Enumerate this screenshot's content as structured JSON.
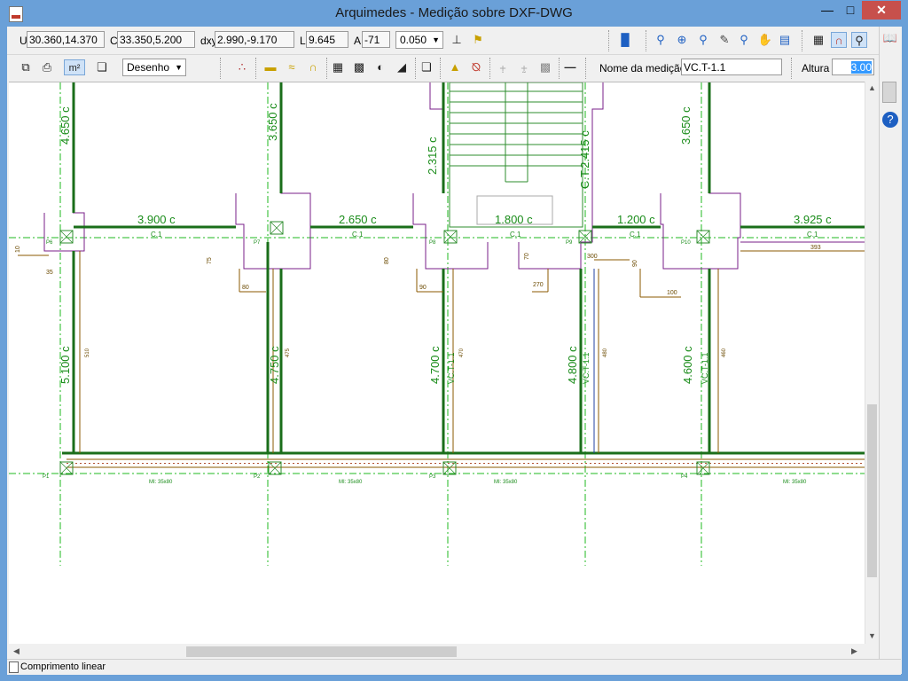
{
  "window": {
    "title": "Arquimedes - Medição sobre DXF-DWG"
  },
  "toolbar1": {
    "u_label": "U",
    "u_value": "30.360,14.370",
    "c_label": "C",
    "c_value": "33.350,5.200",
    "dxy_label": "dxy",
    "dxy_value": "2.990,-9.170",
    "l_label": "L",
    "l_value": "9.645",
    "a_label": "A",
    "a_value": "-71",
    "precision_value": "0.050"
  },
  "toolbar2": {
    "m2_label": "m²",
    "layer_select": "Desenho",
    "measure_name_label": "Nome da medição",
    "measure_name_value": "VC.T-1.1",
    "height_label": "Altura",
    "height_value": "3.00"
  },
  "status": {
    "text": "Comprimento linear"
  },
  "drawing": {
    "top_dims": [
      "3.900 c",
      "2.650 c",
      "1.800 c",
      "1.200 c",
      "3.925 c"
    ],
    "left_vert_dims": [
      "4.650 c",
      "3.650 c",
      "2.315 c",
      "C.T.2.415 c",
      "3.650 c"
    ],
    "lower_vert_dims": [
      "5.100 c",
      "4.750 c",
      "4.700 c",
      "4.800 c",
      "4.600 c"
    ],
    "beam_label": "C.1",
    "vc_label": "VC.T-1.1",
    "wall_label": "MI: 35x80",
    "pillars_top": [
      "P6",
      "P7",
      "P8",
      "P9",
      "P10"
    ],
    "pillars_bottom": [
      "P1",
      "P2",
      "P3",
      "P4"
    ],
    "small_dims": [
      "35",
      "75",
      "80",
      "80",
      "90",
      "70",
      "270",
      "300",
      "90",
      "100",
      "393",
      "10"
    ],
    "inner_nums": [
      "510",
      "475",
      "470",
      "480",
      "460"
    ]
  }
}
